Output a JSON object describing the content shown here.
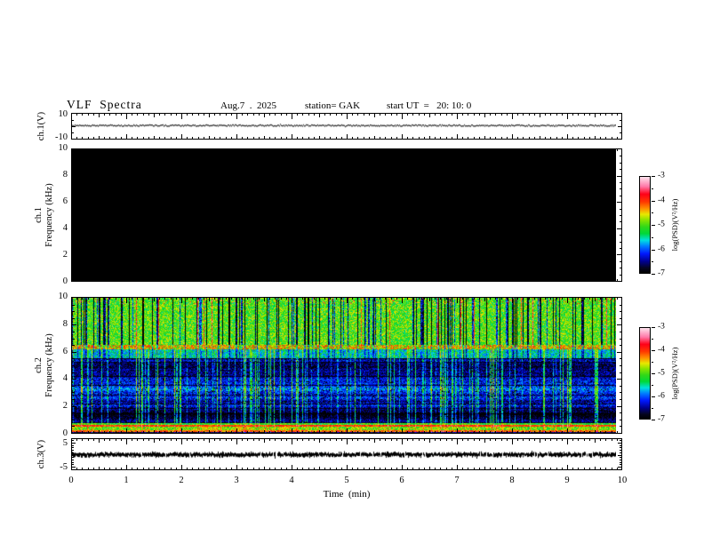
{
  "title": "VLF  Spectra",
  "header": {
    "date": "Aug.7  .  2025",
    "station": "station= GAK",
    "start_ut": "start UT  =   20: 10: 0"
  },
  "panels": {
    "ch1_volt": {
      "label": "ch.1(V)",
      "y_ticks": [
        "10",
        "-10"
      ]
    },
    "spec1": {
      "label_line1": "ch.1",
      "label_line2": "Frequency  (kHz)",
      "y_ticks": [
        "10",
        "8",
        "6",
        "4",
        "2",
        "0"
      ]
    },
    "spec2": {
      "label_line1": "ch.2",
      "label_line2": "Frequency  (kHz)",
      "y_ticks": [
        "10",
        "8",
        "6",
        "4",
        "2",
        "0"
      ]
    },
    "ch3_volt": {
      "label": "ch.3(V)",
      "y_ticks": [
        "5",
        "-5"
      ]
    }
  },
  "time_axis": {
    "label": "Time  (min)",
    "ticks": [
      "0",
      "1",
      "2",
      "3",
      "4",
      "5",
      "6",
      "7",
      "8",
      "9",
      "10"
    ]
  },
  "colorbars": [
    {
      "label": "log(PSD)(V²/Hz)",
      "ticks": [
        "-3",
        "-4",
        "-5",
        "-6",
        "-7"
      ]
    },
    {
      "label": "log(PSD)(V²/Hz)",
      "ticks": [
        "-3",
        "-4",
        "-5",
        "-6",
        "-7"
      ]
    }
  ],
  "colors": {
    "background": "#ffffff",
    "frame": "#000000",
    "ch1_trace": "#333333",
    "ch3_trace": "#000000",
    "spec1_fill": "#000000",
    "colormap_stops": [
      {
        "t": 0.0,
        "c": "#000000"
      },
      {
        "t": 0.05,
        "c": "#050520"
      },
      {
        "t": 0.12,
        "c": "#000090"
      },
      {
        "t": 0.2,
        "c": "#0018ff"
      },
      {
        "t": 0.28,
        "c": "#0080ff"
      },
      {
        "t": 0.34,
        "c": "#00e0e0"
      },
      {
        "t": 0.41,
        "c": "#00d838"
      },
      {
        "t": 0.48,
        "c": "#30d818"
      },
      {
        "t": 0.55,
        "c": "#88e400"
      },
      {
        "t": 0.61,
        "c": "#e8e800"
      },
      {
        "t": 0.67,
        "c": "#ff9000"
      },
      {
        "t": 0.74,
        "c": "#ff3800"
      },
      {
        "t": 0.82,
        "c": "#ff0018"
      },
      {
        "t": 0.9,
        "c": "#ff78a8"
      },
      {
        "t": 1.0,
        "c": "#ffe4ee"
      }
    ]
  },
  "chart_data": [
    {
      "type": "line",
      "name": "ch.1 voltage waveform",
      "ylabel": "ch.1(V)",
      "x_range_min": [
        0,
        10
      ],
      "y_range": [
        -10,
        10
      ],
      "y_tick_values": [
        10,
        -10
      ],
      "description": "Flat noisy trace at ~0 V spanning the full record 0 to ~9.87 min",
      "mean_v": 0,
      "peak_amplitude_v": 0.5
    },
    {
      "type": "heatmap",
      "name": "ch.1 spectrogram",
      "ylabel": "Frequency (kHz)",
      "x_range_min": [
        0,
        9.87
      ],
      "y_range_khz": [
        0,
        10
      ],
      "z_label": "log(PSD)(V²/Hz)",
      "z_range": [
        -7,
        -3
      ],
      "description": "Uniformly black: PSD at or below -7 across all frequencies and times",
      "uniform_value": -7
    },
    {
      "type": "heatmap",
      "name": "ch.2 spectrogram",
      "ylabel": "Frequency (kHz)",
      "x_range_min": [
        0,
        9.87
      ],
      "y_range_khz": [
        0,
        10
      ],
      "z_label": "log(PSD)(V²/Hz)",
      "z_range": [
        -7,
        -3
      ],
      "description": "Bright green band 6.5-10 kHz with dark vertical dropouts and occasional red/orange streaks; speckled yellow/red line near 6.5 kHz; cyan-blue transition 5.5-6.3 kHz; dark blue region 1.5-5.5 kHz with black patches, horizontal banding and thin bright cyan vertical streaks; layered horizontal stripes (red, green, cyan) below 0.8 kHz",
      "bands": [
        {
          "f_lo": 6.55,
          "f_hi": 10.01,
          "base": -5.0,
          "noise": 0.55,
          "zone": "upper"
        },
        {
          "f_lo": 6.25,
          "f_hi": 6.55,
          "base": -4.55,
          "noise": 0.75,
          "zone": "band65"
        },
        {
          "f_lo": 5.55,
          "f_hi": 6.25,
          "base": -5.6,
          "noise": 0.45,
          "zone": "mid"
        },
        {
          "f_lo": 1.55,
          "f_hi": 5.55,
          "base": -6.3,
          "noise": 0.4,
          "zone": "blue"
        },
        {
          "f_lo": 0.78,
          "f_hi": 1.55,
          "base": -6.55,
          "noise": 0.35,
          "zone": "lowblue"
        },
        {
          "f_lo": 0.62,
          "f_hi": 0.78,
          "base": -5.1,
          "noise": 0.5,
          "zone": "cyanline"
        },
        {
          "f_lo": 0.5,
          "f_hi": 0.62,
          "base": -4.0,
          "noise": 0.35,
          "zone": "redline"
        },
        {
          "f_lo": 0.2,
          "f_hi": 0.5,
          "base": -4.9,
          "noise": 0.55,
          "zone": "greenband"
        },
        {
          "f_lo": 0.13,
          "f_hi": 0.2,
          "base": -4.2,
          "noise": 0.4,
          "zone": "redline2"
        },
        {
          "f_lo": 0.0,
          "f_hi": 0.13,
          "base": -6.7,
          "noise": 0.3,
          "zone": "dark"
        }
      ],
      "features": {
        "dark_vertical_streak_prob": 0.2,
        "bright_vertical_streak_prob": 0.2,
        "hot_streak_prob": 0.03,
        "black_speckle_prob": 0.07,
        "top_edge_red_fleck_prob": 0.04,
        "low_freq_green_patches_min": [
          2.5,
          3.1,
          3.85
        ]
      }
    },
    {
      "type": "line",
      "name": "ch.3 voltage waveform",
      "ylabel": "ch.3(V)",
      "x_range_min": [
        0,
        10
      ],
      "y_range": [
        -6.5,
        6.5
      ],
      "y_tick_values": [
        5,
        -5
      ],
      "description": "Thick dense noisy black band near 0 V (~±1 V) spanning the full record 0 to ~9.87 min",
      "mean_v": 0,
      "peak_amplitude_v": 1.2
    }
  ]
}
